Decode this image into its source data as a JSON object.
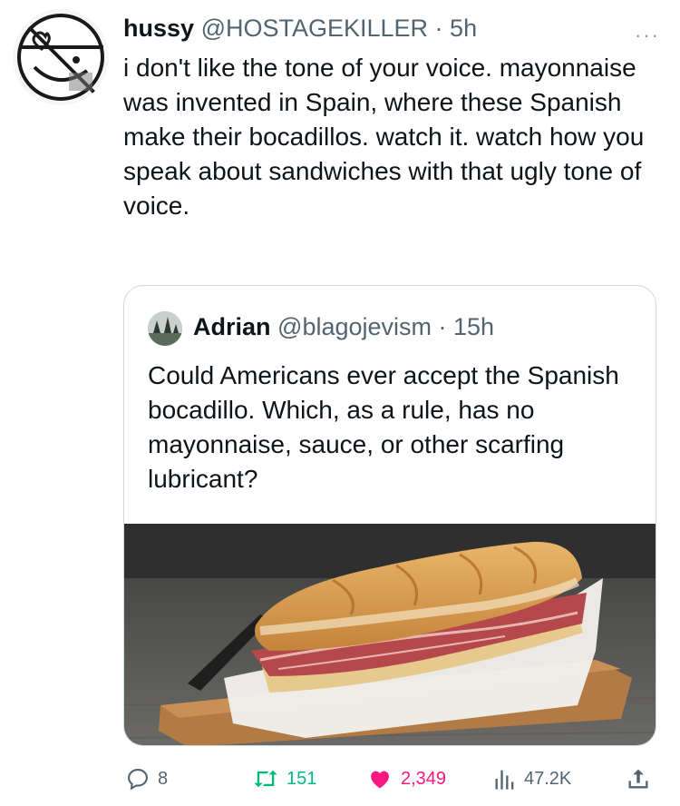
{
  "tweet": {
    "author_name": "hussy",
    "handle": "@HOSTAGEKILLER",
    "time_sep": " · ",
    "time": "5h",
    "more_label": "···",
    "text": "i don't like the tone of your voice. mayonnaise was invented in Spain, where these Spanish make their bocadillos. watch it. watch how you speak about sandwiches with that ugly tone of voice."
  },
  "quote": {
    "author_name": "Adrian",
    "handle": "@blagojevism",
    "time_sep": " · ",
    "time": "15h",
    "text": "Could Americans ever accept the Spanish bocadillo. Which, as a rule, has no mayonnaise, sauce, or other scarfing lubricant?",
    "media_icon": "sandwich-photo"
  },
  "actions": {
    "replies": "8",
    "retweets": "151",
    "likes": "2,349",
    "views": "47.2K"
  },
  "colors": {
    "text": "#0f1419",
    "muted": "#536471",
    "retweet": "#00ba7c",
    "like": "#f91880",
    "border": "#cfd9de"
  }
}
